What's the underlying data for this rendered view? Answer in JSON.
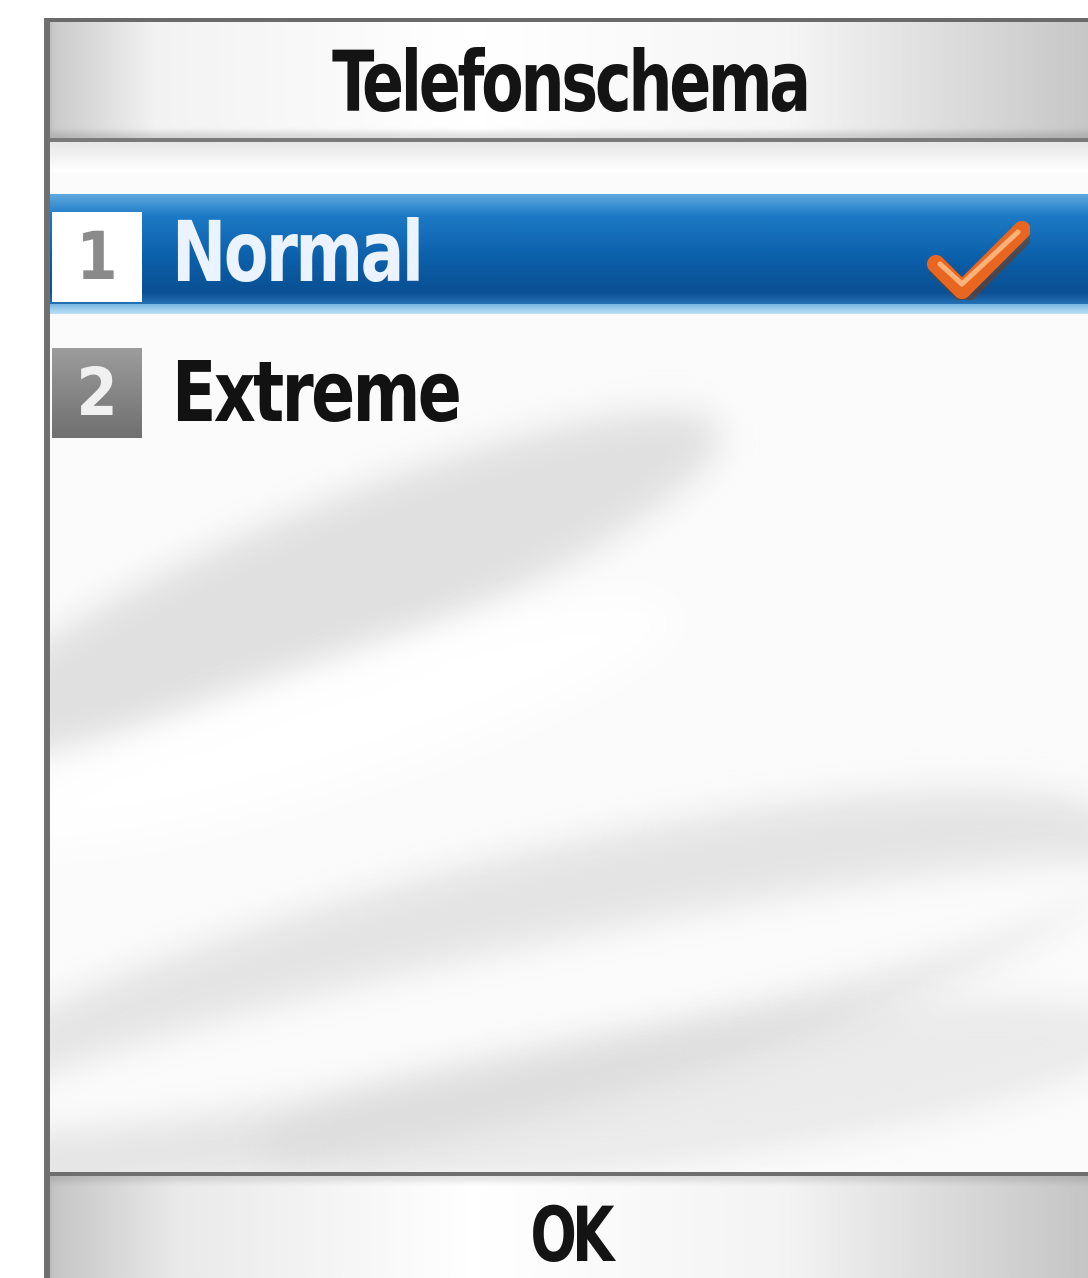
{
  "screen": {
    "title": "Telefonschema"
  },
  "list": {
    "items": [
      {
        "number": "1",
        "label": "Normal",
        "selected": true,
        "checked": true
      },
      {
        "number": "2",
        "label": "Extreme",
        "selected": false,
        "checked": false
      }
    ],
    "check_icon": "checkmark-icon"
  },
  "softkeys": {
    "center_label": "OK"
  },
  "colors": {
    "highlight": "#0b5ea8",
    "checkmark": "#e05a1e",
    "title_text": "#141414"
  }
}
